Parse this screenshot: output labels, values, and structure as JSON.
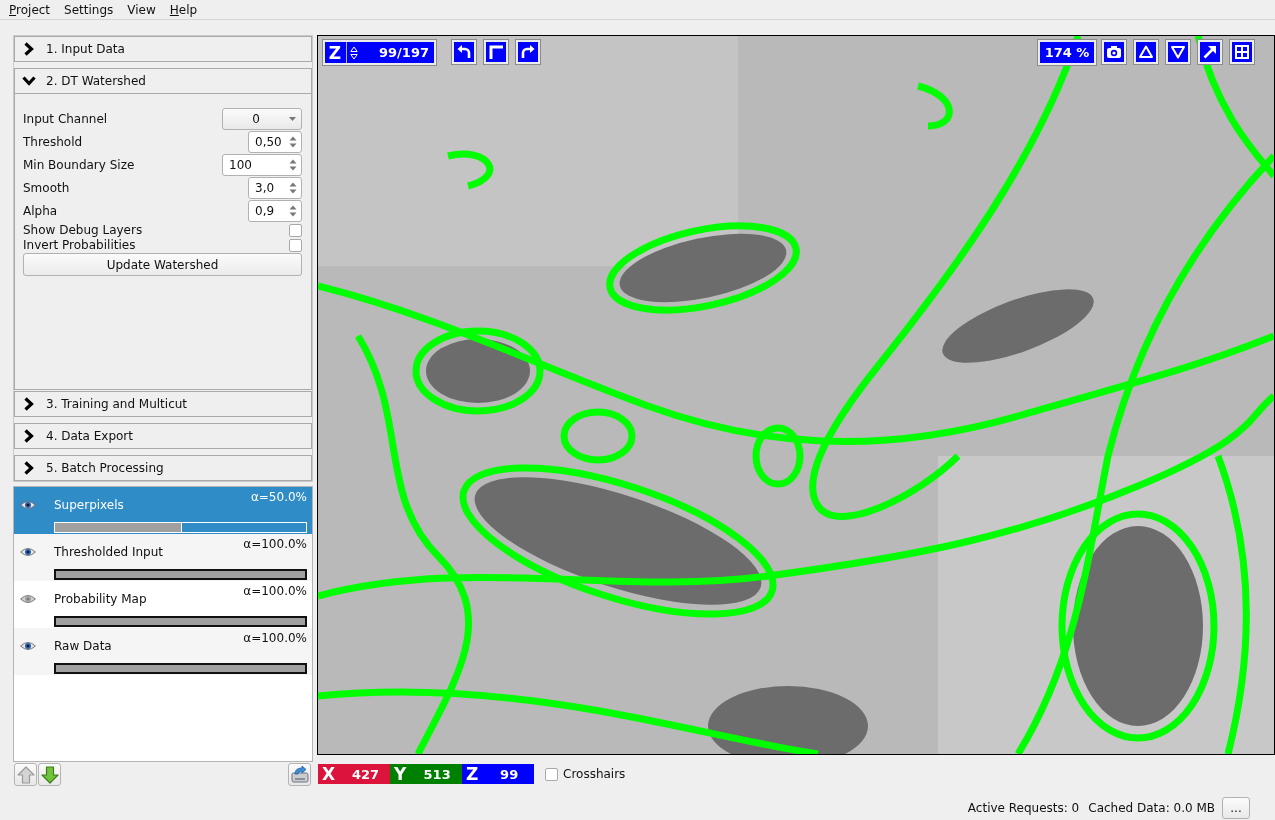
{
  "menu_bar": [
    {
      "label": "Project",
      "mnemonic": true
    },
    {
      "label": "Settings",
      "mnemonic": false
    },
    {
      "label": "View",
      "mnemonic": false
    },
    {
      "label": "Help",
      "mnemonic": true
    }
  ],
  "applets": [
    {
      "title": "1. Input Data",
      "expanded": false
    },
    {
      "title": "2. DT Watershed",
      "expanded": true,
      "settings": {
        "fields": [
          {
            "kind": "dropdown",
            "label": "Input Channel",
            "value": "0"
          },
          {
            "kind": "decimal",
            "label": "Threshold",
            "value": "0,50"
          },
          {
            "kind": "integer",
            "label": "Min Boundary Size",
            "value": "100"
          },
          {
            "kind": "decimal",
            "label": "Smooth",
            "value": "3,0"
          },
          {
            "kind": "decimal",
            "label": "Alpha",
            "value": "0,9"
          },
          {
            "kind": "checkbox",
            "label": "Show Debug Layers",
            "checked": false
          },
          {
            "kind": "checkbox",
            "label": "Invert Probabilities",
            "checked": false
          }
        ],
        "button": "Update Watershed"
      }
    },
    {
      "title": "3. Training and Multicut",
      "expanded": false
    },
    {
      "title": "4. Data Export",
      "expanded": false
    },
    {
      "title": "5. Batch Processing",
      "expanded": false
    }
  ],
  "layers": [
    {
      "name": "Superpixels",
      "opacity": "α=50.0%",
      "level": 0.5,
      "visible": true,
      "selected": true
    },
    {
      "name": "Thresholded Input",
      "opacity": "α=100.0%",
      "level": 1.0,
      "visible": true,
      "selected": false
    },
    {
      "name": "Probability Map",
      "opacity": "α=100.0%",
      "level": 1.0,
      "visible": false,
      "selected": false
    },
    {
      "name": "Raw Data",
      "opacity": "α=100.0%",
      "level": 1.0,
      "visible": true,
      "selected": false
    }
  ],
  "layer_buttons": {
    "move_up": {
      "disabled": true
    },
    "move_down": {
      "disabled": false
    }
  },
  "viewer": {
    "slice": {
      "axis": "Z",
      "position": "99/197"
    },
    "zoom": "174 %",
    "coordinates": [
      {
        "axis": "X",
        "value": "427",
        "color": "#dc143c"
      },
      {
        "axis": "Y",
        "value": "513",
        "color": "#008000"
      },
      {
        "axis": "Z",
        "value": "99",
        "color": "#0000ff"
      }
    ],
    "crosshairs": {
      "label": "Crosshairs",
      "checked": false
    }
  },
  "status_bar": {
    "active_requests": "Active Requests: 0",
    "cached_data": "Cached Data: 0.0 MB",
    "button": "..."
  }
}
